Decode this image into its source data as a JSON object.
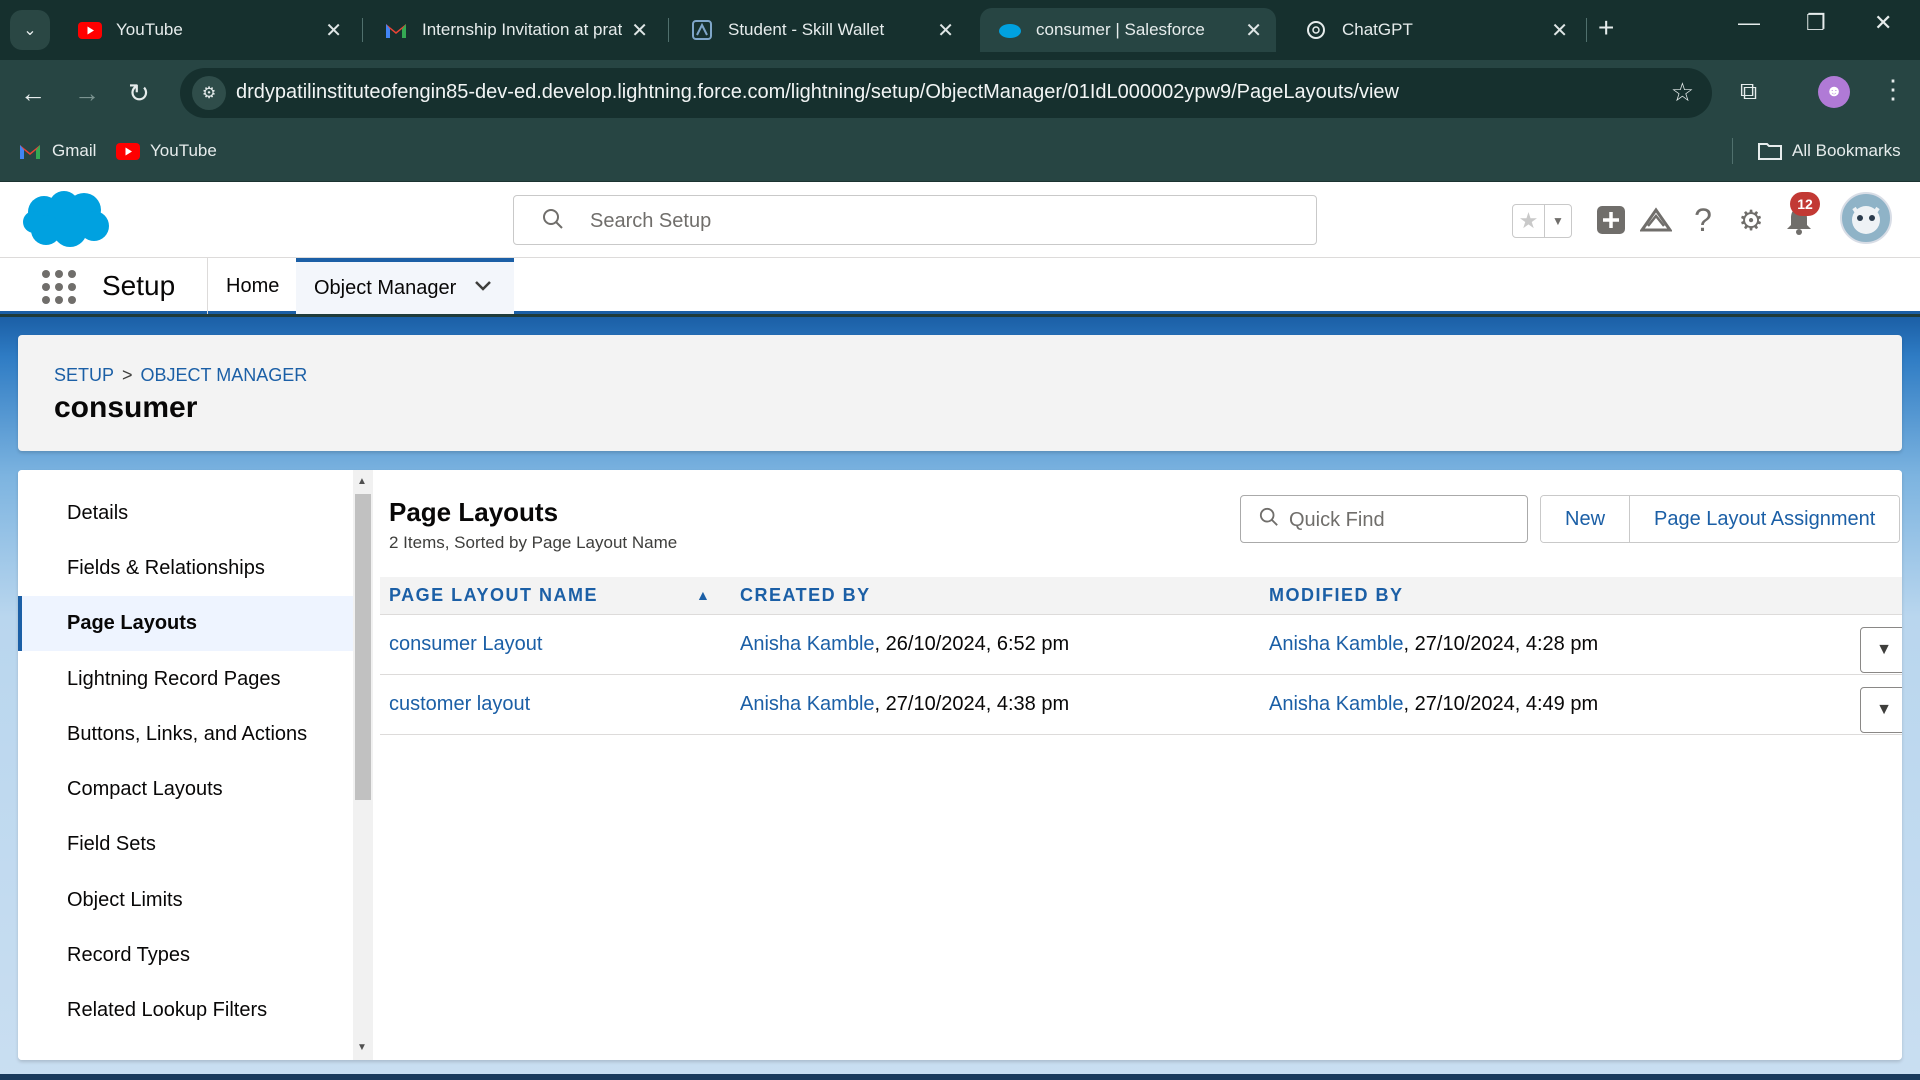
{
  "browser": {
    "tabs": [
      {
        "title": "YouTube",
        "favicon": "youtube-icon"
      },
      {
        "title": "Internship Invitation at prat",
        "favicon": "gmail-icon"
      },
      {
        "title": "Student - Skill Wallet",
        "favicon": "skill-wallet-icon"
      },
      {
        "title": "consumer | Salesforce",
        "favicon": "salesforce-icon",
        "active": true
      },
      {
        "title": "ChatGPT",
        "favicon": "chatgpt-icon"
      }
    ],
    "url": "drdypatilinstituteofengin85-dev-ed.develop.lightning.force.com/lightning/setup/ObjectManager/01IdL000002ypw9/PageLayouts/view",
    "bookmarks": [
      {
        "label": "Gmail",
        "icon": "gmail-icon"
      },
      {
        "label": "YouTube",
        "icon": "youtube-icon"
      }
    ],
    "all_bookmarks_label": "All Bookmarks"
  },
  "sf_header": {
    "search_placeholder": "Search Setup",
    "notification_count": "12"
  },
  "sf_nav": {
    "app_name": "Setup",
    "items": [
      {
        "label": "Home"
      },
      {
        "label": "Object Manager",
        "active": true
      }
    ]
  },
  "page_header": {
    "breadcrumbs": [
      "SETUP",
      "OBJECT MANAGER"
    ],
    "breadcrumb_separator": ">",
    "title": "consumer"
  },
  "sidebar": {
    "items": [
      {
        "label": "Details"
      },
      {
        "label": "Fields & Relationships"
      },
      {
        "label": "Page Layouts",
        "active": true
      },
      {
        "label": "Lightning Record Pages"
      },
      {
        "label": "Buttons, Links, and Actions"
      },
      {
        "label": "Compact Layouts"
      },
      {
        "label": "Field Sets"
      },
      {
        "label": "Object Limits"
      },
      {
        "label": "Record Types"
      },
      {
        "label": "Related Lookup Filters"
      }
    ]
  },
  "main": {
    "title": "Page Layouts",
    "subtitle": "2 Items, Sorted by Page Layout Name",
    "quick_find_placeholder": "Quick Find",
    "new_label": "New",
    "assignment_label": "Page Layout Assignment",
    "columns": [
      "PAGE LAYOUT NAME",
      "CREATED BY",
      "MODIFIED BY"
    ],
    "rows": [
      {
        "name": "consumer Layout",
        "created_by": "Anisha Kamble",
        "created_at": ", 26/10/2024, 6:52 pm",
        "modified_by": "Anisha Kamble",
        "modified_at": ", 27/10/2024, 4:28 pm"
      },
      {
        "name": "customer layout",
        "created_by": "Anisha Kamble",
        "created_at": ", 27/10/2024, 4:38 pm",
        "modified_by": "Anisha Kamble",
        "modified_at": ", 27/10/2024, 4:49 pm"
      }
    ]
  },
  "colors": {
    "brand_blue": "#1b5fa6",
    "chrome_dark": "#16302e",
    "chrome_mid": "#274543",
    "badge_red": "#c23934"
  }
}
